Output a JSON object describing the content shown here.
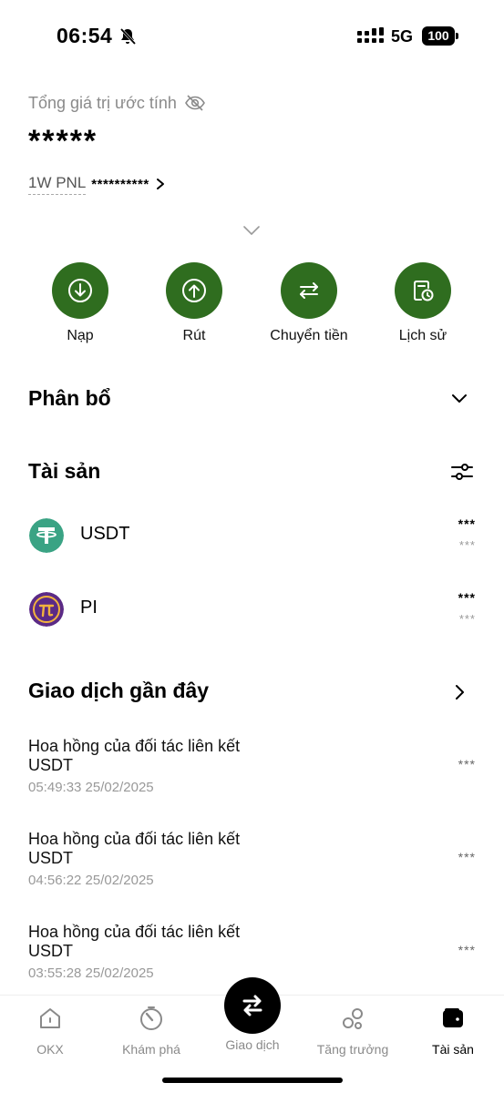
{
  "status_bar": {
    "time": "06:54",
    "network": "5G",
    "battery": "100"
  },
  "balance": {
    "label": "Tổng giá trị ước tính",
    "value": "*****",
    "pnl_label": "1W PNL",
    "pnl_value": "**********"
  },
  "actions": [
    {
      "label": "Nạp",
      "icon": "deposit-icon"
    },
    {
      "label": "Rút",
      "icon": "withdraw-icon"
    },
    {
      "label": "Chuyển tiền",
      "icon": "transfer-icon"
    },
    {
      "label": "Lịch sử",
      "icon": "history-icon"
    }
  ],
  "allocation": {
    "title": "Phân bổ"
  },
  "assets": {
    "title": "Tài sản",
    "items": [
      {
        "name": "USDT",
        "amount": "***",
        "usd": "***",
        "color": "#3aa384"
      },
      {
        "name": "PI",
        "amount": "***",
        "usd": "***",
        "color": "#5b2a86"
      }
    ]
  },
  "transactions": {
    "title": "Giao dịch gần đây",
    "items": [
      {
        "title": "Hoa hồng của đối tác liên kết USDT",
        "time": "05:49:33 25/02/2025",
        "amount": "***"
      },
      {
        "title": "Hoa hồng của đối tác liên kết USDT",
        "time": "04:56:22 25/02/2025",
        "amount": "***"
      },
      {
        "title": "Hoa hồng của đối tác liên kết USDT",
        "time": "03:55:28 25/02/2025",
        "amount": "***"
      }
    ]
  },
  "nav": {
    "items": [
      {
        "label": "OKX",
        "icon": "home-icon"
      },
      {
        "label": "Khám phá",
        "icon": "explore-icon"
      },
      {
        "label": "Giao dịch",
        "icon": "trade-icon"
      },
      {
        "label": "Tăng trưởng",
        "icon": "growth-icon"
      },
      {
        "label": "Tài sản",
        "icon": "wallet-icon"
      }
    ],
    "active": "Tài sản"
  },
  "colors": {
    "accent": "#2f6d1f",
    "muted": "#8a8a8a"
  }
}
